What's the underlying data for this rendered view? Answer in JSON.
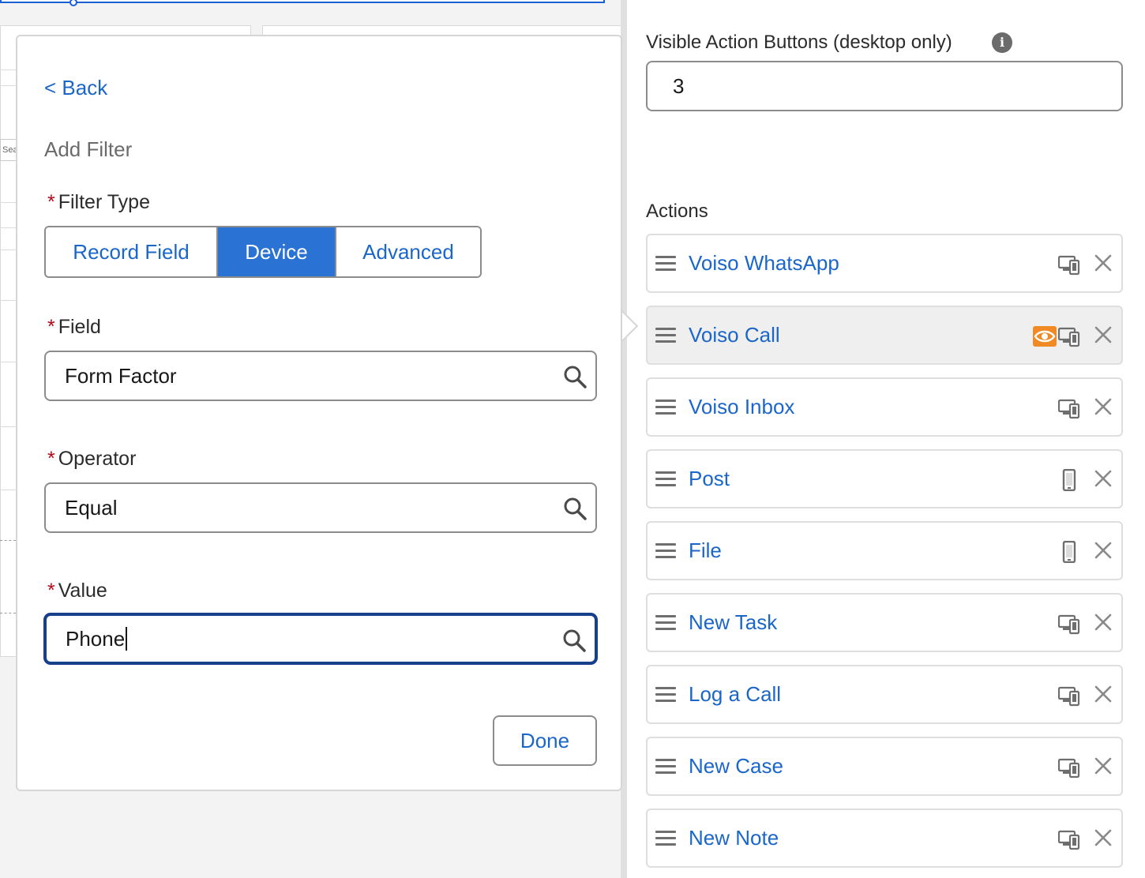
{
  "right_panel": {
    "visible_buttons_label": "Visible Action Buttons (desktop only)",
    "visible_buttons_value": "3",
    "actions_label": "Actions",
    "actions": [
      {
        "label": "Voiso WhatsApp",
        "device_icon": "desktop-phone-icon",
        "filtered": false
      },
      {
        "label": "Voiso Call",
        "device_icon": "desktop-phone-icon",
        "filtered": true
      },
      {
        "label": "Voiso Inbox",
        "device_icon": "desktop-phone-icon",
        "filtered": false
      },
      {
        "label": "Post",
        "device_icon": "phone-icon",
        "filtered": false
      },
      {
        "label": "File",
        "device_icon": "phone-icon",
        "filtered": false
      },
      {
        "label": "New Task",
        "device_icon": "desktop-phone-icon",
        "filtered": false
      },
      {
        "label": "Log a Call",
        "device_icon": "desktop-phone-icon",
        "filtered": false
      },
      {
        "label": "New Case",
        "device_icon": "desktop-phone-icon",
        "filtered": false
      },
      {
        "label": "New Note",
        "device_icon": "desktop-phone-icon",
        "filtered": false
      }
    ]
  },
  "popover": {
    "back_label": "< Back",
    "title": "Add Filter",
    "filter_type_label": "Filter Type",
    "filter_type_options": [
      "Record Field",
      "Device",
      "Advanced"
    ],
    "filter_type_selected": "Device",
    "field_label": "Field",
    "field_value": "Form Factor",
    "operator_label": "Operator",
    "operator_value": "Equal",
    "value_label": "Value",
    "value_value": "Phone",
    "done_label": "Done",
    "required_marker": "*"
  },
  "background": {
    "search_stub": "Sea"
  },
  "colors": {
    "link_blue": "#1b66c9",
    "selected_segment": "#2a72d4",
    "required_red": "#ba0517",
    "filter_badge_orange": "#f08a24"
  }
}
